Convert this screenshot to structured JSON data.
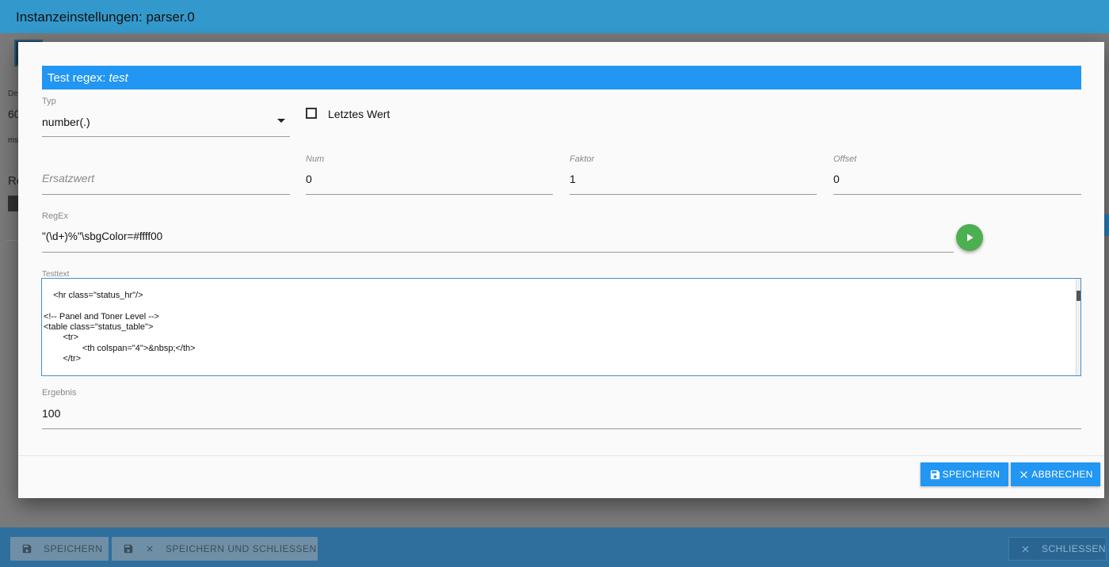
{
  "window": {
    "title": "Instanzeinstellungen: parser.0"
  },
  "background": {
    "text_1": "De",
    "text_2": "60",
    "text_3": "ms",
    "text_4": "Re",
    "footer": {
      "save_label": "SPEICHERN",
      "save_close_label": "SPEICHERN UND SCHLIESSEN",
      "close_label": "SCHLIESSEN"
    }
  },
  "dialog": {
    "title_prefix": "Test regex: ",
    "title_name": "test",
    "typ": {
      "label": "Typ",
      "value": "number(.)"
    },
    "letztes_wert": {
      "label": "Letztes Wert",
      "checked": false
    },
    "ersatzwert": {
      "placeholder": "Ersatzwert"
    },
    "num": {
      "label": "Num",
      "value": "0"
    },
    "faktor": {
      "label": "Faktor",
      "value": "1"
    },
    "offset": {
      "label": "Offset",
      "value": "0"
    },
    "regex": {
      "label": "RegEx",
      "value": "\"(\\d+)%\"\\sbgColor=#ffff00"
    },
    "testtext": {
      "label": "Testtext",
      "value": "<hr class=\"status_hr\"/>\n\n<!-- Panel and Toner Level -->\n<table class=\"status_table\">\n\t<tr>\n\t\t<th colspan=\"4\">&nbsp;</th>\n\t</tr>"
    },
    "ergebnis": {
      "label": "Ergebnis",
      "value": "100"
    },
    "buttons": {
      "save_label": "SPEICHERN",
      "cancel_label": "ABBRECHEN"
    }
  },
  "colors": {
    "header_blue": "#3399cc",
    "accent": "#2196f3",
    "run_green": "#4caf50"
  }
}
